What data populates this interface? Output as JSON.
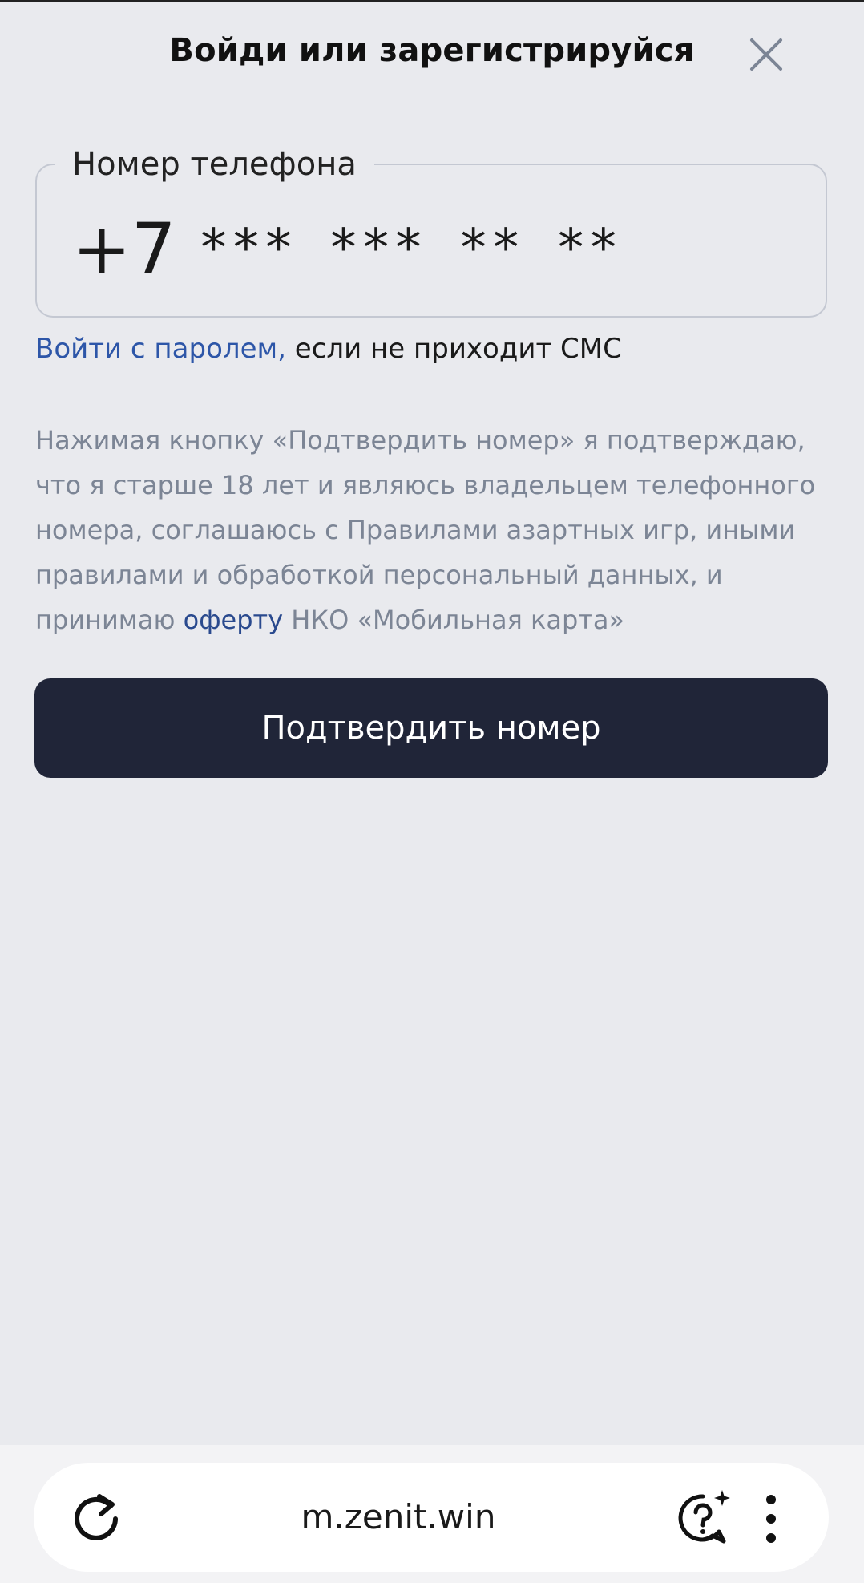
{
  "header": {
    "title": "Войди или зарегистрируйся",
    "close_icon": "close-icon"
  },
  "phone_field": {
    "label": "Номер телефона",
    "prefix": "+7",
    "mask": "*** *** ** **"
  },
  "password_login": {
    "link_text": "Войти с паролем,",
    "suffix_text": " если не приходит СМС"
  },
  "disclaimer": {
    "text_before": "Нажимая кнопку «Подтвердить номер» я подтверждаю, что я старше 18 лет и являюсь владельцем телефонного номера, соглашаюсь с Правилами азартных игр, иными правилами и обработкой персональный данных, и принимаю ",
    "offer_link": "оферту",
    "text_after": " НКО «Мобильная карта»"
  },
  "confirm_button": {
    "label": "Подтвердить номер"
  },
  "browser_bar": {
    "url": "m.zenit.win",
    "reload_icon": "reload-icon",
    "assistant_icon": "assistant-help-icon",
    "menu_icon": "more-vertical-icon"
  },
  "colors": {
    "background": "#E9EAEE",
    "button": "#202538",
    "link": "#2D56A8",
    "muted_text": "#7C8595"
  }
}
